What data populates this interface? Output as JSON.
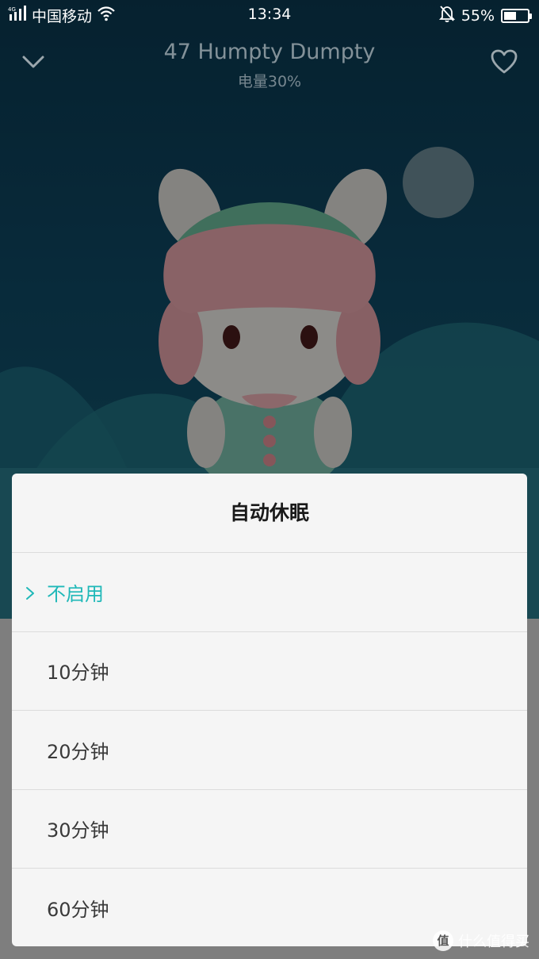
{
  "status_bar": {
    "network": "4G",
    "carrier": "中国移动",
    "time": "13:34",
    "battery": "55%",
    "battery_level": 0.55,
    "icons": [
      "signal-icon",
      "wifi-icon",
      "bell-off-icon",
      "battery-icon"
    ]
  },
  "header": {
    "title": "47 Humpty Dumpty",
    "subtitle": "电量30%",
    "icons": [
      "chevron-down-icon",
      "heart-icon"
    ]
  },
  "dialog": {
    "title": "自动休眠",
    "options": [
      {
        "label": "不启用",
        "selected": true
      },
      {
        "label": "10分钟",
        "selected": false
      },
      {
        "label": "20分钟",
        "selected": false
      },
      {
        "label": "30分钟",
        "selected": false
      },
      {
        "label": "60分钟",
        "selected": false
      }
    ],
    "accent": "#1fb8b8"
  },
  "watermark": {
    "badge": "值",
    "text": "什么值得买"
  }
}
